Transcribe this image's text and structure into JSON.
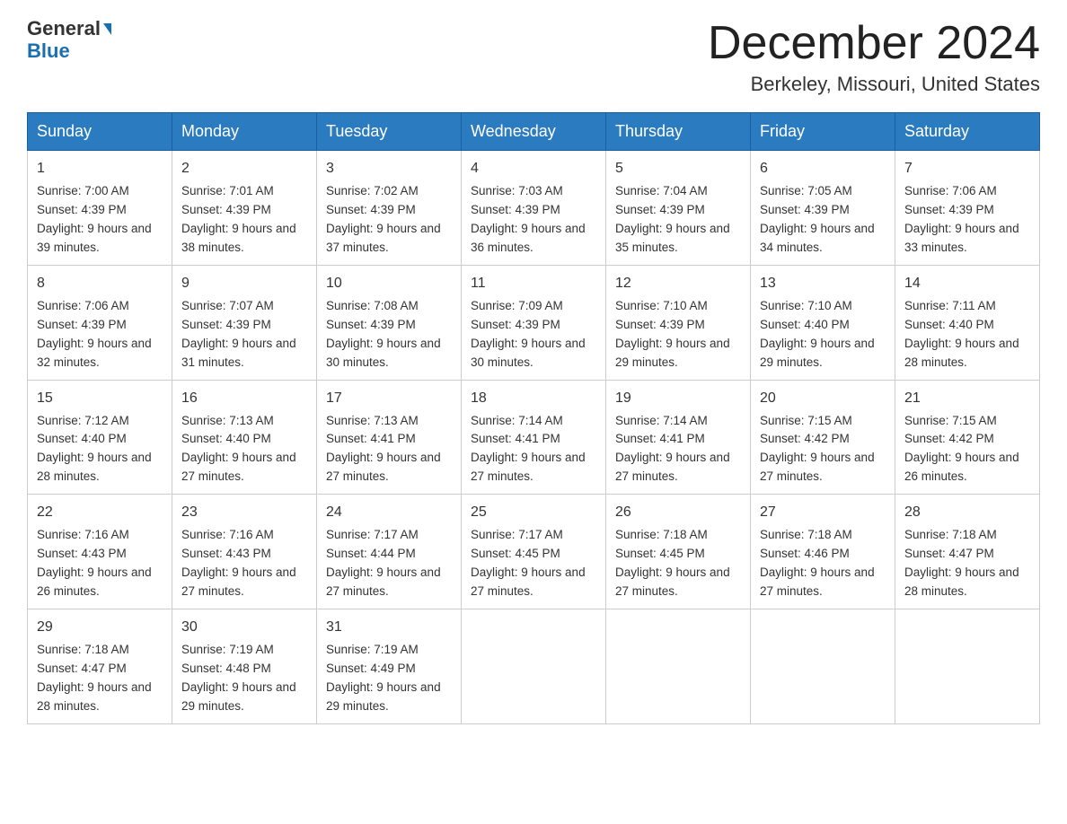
{
  "header": {
    "logo_line1": "General",
    "logo_line2": "Blue",
    "month_title": "December 2024",
    "location": "Berkeley, Missouri, United States"
  },
  "weekdays": [
    "Sunday",
    "Monday",
    "Tuesday",
    "Wednesday",
    "Thursday",
    "Friday",
    "Saturday"
  ],
  "weeks": [
    [
      {
        "day": "1",
        "sunrise": "7:00 AM",
        "sunset": "4:39 PM",
        "daylight": "9 hours and 39 minutes."
      },
      {
        "day": "2",
        "sunrise": "7:01 AM",
        "sunset": "4:39 PM",
        "daylight": "9 hours and 38 minutes."
      },
      {
        "day": "3",
        "sunrise": "7:02 AM",
        "sunset": "4:39 PM",
        "daylight": "9 hours and 37 minutes."
      },
      {
        "day": "4",
        "sunrise": "7:03 AM",
        "sunset": "4:39 PM",
        "daylight": "9 hours and 36 minutes."
      },
      {
        "day": "5",
        "sunrise": "7:04 AM",
        "sunset": "4:39 PM",
        "daylight": "9 hours and 35 minutes."
      },
      {
        "day": "6",
        "sunrise": "7:05 AM",
        "sunset": "4:39 PM",
        "daylight": "9 hours and 34 minutes."
      },
      {
        "day": "7",
        "sunrise": "7:06 AM",
        "sunset": "4:39 PM",
        "daylight": "9 hours and 33 minutes."
      }
    ],
    [
      {
        "day": "8",
        "sunrise": "7:06 AM",
        "sunset": "4:39 PM",
        "daylight": "9 hours and 32 minutes."
      },
      {
        "day": "9",
        "sunrise": "7:07 AM",
        "sunset": "4:39 PM",
        "daylight": "9 hours and 31 minutes."
      },
      {
        "day": "10",
        "sunrise": "7:08 AM",
        "sunset": "4:39 PM",
        "daylight": "9 hours and 30 minutes."
      },
      {
        "day": "11",
        "sunrise": "7:09 AM",
        "sunset": "4:39 PM",
        "daylight": "9 hours and 30 minutes."
      },
      {
        "day": "12",
        "sunrise": "7:10 AM",
        "sunset": "4:39 PM",
        "daylight": "9 hours and 29 minutes."
      },
      {
        "day": "13",
        "sunrise": "7:10 AM",
        "sunset": "4:40 PM",
        "daylight": "9 hours and 29 minutes."
      },
      {
        "day": "14",
        "sunrise": "7:11 AM",
        "sunset": "4:40 PM",
        "daylight": "9 hours and 28 minutes."
      }
    ],
    [
      {
        "day": "15",
        "sunrise": "7:12 AM",
        "sunset": "4:40 PM",
        "daylight": "9 hours and 28 minutes."
      },
      {
        "day": "16",
        "sunrise": "7:13 AM",
        "sunset": "4:40 PM",
        "daylight": "9 hours and 27 minutes."
      },
      {
        "day": "17",
        "sunrise": "7:13 AM",
        "sunset": "4:41 PM",
        "daylight": "9 hours and 27 minutes."
      },
      {
        "day": "18",
        "sunrise": "7:14 AM",
        "sunset": "4:41 PM",
        "daylight": "9 hours and 27 minutes."
      },
      {
        "day": "19",
        "sunrise": "7:14 AM",
        "sunset": "4:41 PM",
        "daylight": "9 hours and 27 minutes."
      },
      {
        "day": "20",
        "sunrise": "7:15 AM",
        "sunset": "4:42 PM",
        "daylight": "9 hours and 27 minutes."
      },
      {
        "day": "21",
        "sunrise": "7:15 AM",
        "sunset": "4:42 PM",
        "daylight": "9 hours and 26 minutes."
      }
    ],
    [
      {
        "day": "22",
        "sunrise": "7:16 AM",
        "sunset": "4:43 PM",
        "daylight": "9 hours and 26 minutes."
      },
      {
        "day": "23",
        "sunrise": "7:16 AM",
        "sunset": "4:43 PM",
        "daylight": "9 hours and 27 minutes."
      },
      {
        "day": "24",
        "sunrise": "7:17 AM",
        "sunset": "4:44 PM",
        "daylight": "9 hours and 27 minutes."
      },
      {
        "day": "25",
        "sunrise": "7:17 AM",
        "sunset": "4:45 PM",
        "daylight": "9 hours and 27 minutes."
      },
      {
        "day": "26",
        "sunrise": "7:18 AM",
        "sunset": "4:45 PM",
        "daylight": "9 hours and 27 minutes."
      },
      {
        "day": "27",
        "sunrise": "7:18 AM",
        "sunset": "4:46 PM",
        "daylight": "9 hours and 27 minutes."
      },
      {
        "day": "28",
        "sunrise": "7:18 AM",
        "sunset": "4:47 PM",
        "daylight": "9 hours and 28 minutes."
      }
    ],
    [
      {
        "day": "29",
        "sunrise": "7:18 AM",
        "sunset": "4:47 PM",
        "daylight": "9 hours and 28 minutes."
      },
      {
        "day": "30",
        "sunrise": "7:19 AM",
        "sunset": "4:48 PM",
        "daylight": "9 hours and 29 minutes."
      },
      {
        "day": "31",
        "sunrise": "7:19 AM",
        "sunset": "4:49 PM",
        "daylight": "9 hours and 29 minutes."
      },
      null,
      null,
      null,
      null
    ]
  ]
}
